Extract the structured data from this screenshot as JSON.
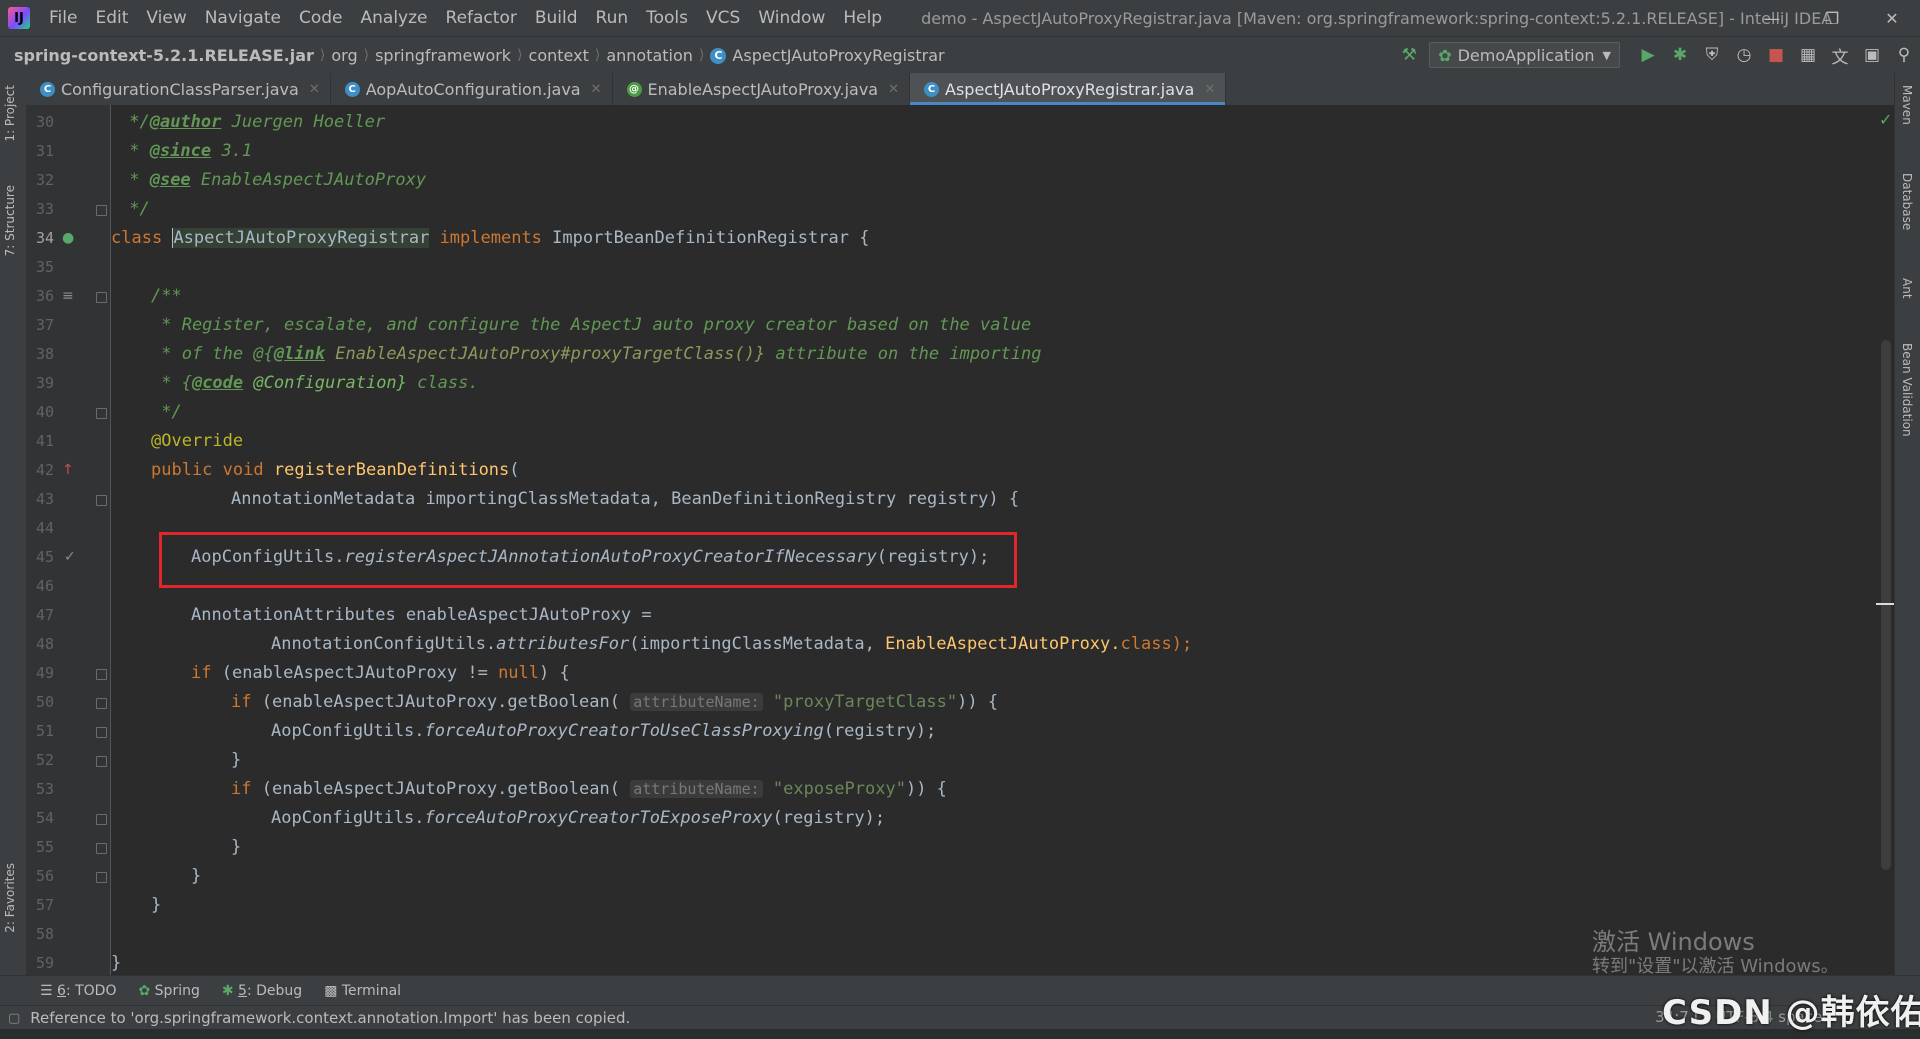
{
  "menubar": {
    "items": [
      "File",
      "Edit",
      "View",
      "Navigate",
      "Code",
      "Analyze",
      "Refactor",
      "Build",
      "Run",
      "Tools",
      "VCS",
      "Window",
      "Help"
    ],
    "title": "demo - AspectJAutoProxyRegistrar.java [Maven: org.springframework:spring-context:5.2.1.RELEASE] - IntelliJ IDEA"
  },
  "breadcrumbs": [
    "spring-context-5.2.1.RELEASE.jar",
    "org",
    "springframework",
    "context",
    "annotation",
    "AspectJAutoProxyRegistrar"
  ],
  "toolbar": {
    "run_config": "DemoApplication"
  },
  "tabs": [
    {
      "label": "ConfigurationClassParser.java",
      "icon": "class-icon",
      "active": false
    },
    {
      "label": "AopAutoConfiguration.java",
      "icon": "class-icon",
      "active": false
    },
    {
      "label": "EnableAspectJAutoProxy.java",
      "icon": "annotation-icon",
      "active": false
    },
    {
      "label": "AspectJAutoProxyRegistrar.java",
      "icon": "class-icon",
      "active": true
    }
  ],
  "left_tools": [
    "1: Project",
    "7: Structure",
    "2: Favorites"
  ],
  "right_tools": [
    "Maven",
    "Database",
    "Ant",
    "Bean Validation"
  ],
  "editor": {
    "line_numbers": [
      "30",
      "31",
      "32",
      "33",
      "34",
      "35",
      "36",
      "37",
      "38",
      "39",
      "40",
      "41",
      "42",
      "43",
      "44",
      "45",
      "46",
      "47",
      "48",
      "49",
      "50",
      "51",
      "52",
      "53",
      "54",
      "55",
      "56",
      "57",
      "58",
      "59"
    ],
    "comment_author_tag": "@author",
    "comment_author": " Juergen Hoeller",
    "comment_since_tag": "@since",
    "comment_since": " 3.1",
    "comment_see_tag": "@see",
    "comment_see": " EnableAspectJAutoProxy",
    "comment_end": " */",
    "kw_class": "class",
    "class_name": "AspectJAutoProxyRegistrar",
    "kw_implements": "implements",
    "interface_name": " ImportBeanDefinitionRegistrar {",
    "doc_open": "/**",
    "doc_line1": " * Register, escalate, and configure the AspectJ auto proxy creator based on the value",
    "doc_line2_a": " * of the @{",
    "doc_link_tag": "@link",
    "doc_line2_b": " EnableAspectJAutoProxy#proxyTargetClass()}",
    "doc_line2_c": " attribute on the importing",
    "doc_line3_a": " * {",
    "doc_code_tag": "@code",
    "doc_line3_b": " @Configuration}",
    "doc_line3_c": " class.",
    "doc_close": " */",
    "annotation_override": "@Override",
    "kw_public": "public",
    "kw_void": "void",
    "method_name": "registerBeanDefinitions",
    "params": "AnnotationMetadata importingClassMetadata, BeanDefinitionRegistry registry) {",
    "highlighted_call_a": "AopConfigUtils.",
    "highlighted_call_b": "registerAspectJAnnotationAutoProxyCreatorIfNecessary",
    "highlighted_call_c": "(registry);",
    "l47": "AnnotationAttributes enableAspectJAutoProxy =",
    "l48_a": "AnnotationConfigUtils.",
    "l48_b": "attributesFor",
    "l48_c": "(importingClassMetadata, ",
    "l48_d": "EnableAspectJAutoProxy.",
    "l48_e": "class",
    "l49_a": "if",
    "l49_b": " (enableAspectJAutoProxy != ",
    "l49_c": "null",
    "l49_d": ") {",
    "l50_a": "if",
    "l50_b": " (enableAspectJAutoProxy.getBoolean(",
    "hint_attr": "attributeName:",
    "l50_str": "\"proxyTargetClass\"",
    "l50_c": ")) {",
    "l51_a": "AopConfigUtils.",
    "l51_b": "forceAutoProxyCreatorToUseClassProxying",
    "l51_c": "(registry);",
    "brace": "}",
    "l53_str": "\"exposeProxy\"",
    "l54_b": "forceAutoProxyCreatorToExposeProxy"
  },
  "bottom_tools": [
    {
      "num": "6",
      "label": ": TODO"
    },
    {
      "num": "",
      "label": "Spring"
    },
    {
      "num": "5",
      "label": ": Debug"
    },
    {
      "num": "",
      "label": "Terminal"
    }
  ],
  "status": {
    "message": "Reference to 'org.springframework.context.annotation.Import' has been copied.",
    "right": "34:7  LF  UTF-8  4 spaces"
  },
  "watermark": {
    "activate_line1": "激活 Windows",
    "activate_line2": "转到\"设置\"以激活 Windows。",
    "csdn": "CSDN @韩依佑"
  },
  "colors": {
    "keyword": "#cc7832",
    "comment": "#629755",
    "string": "#6a8759",
    "function": "#ffc66d",
    "annotation": "#bbb529",
    "highlight_box": "#e0262a",
    "tab_accent": "#4a88c7"
  }
}
